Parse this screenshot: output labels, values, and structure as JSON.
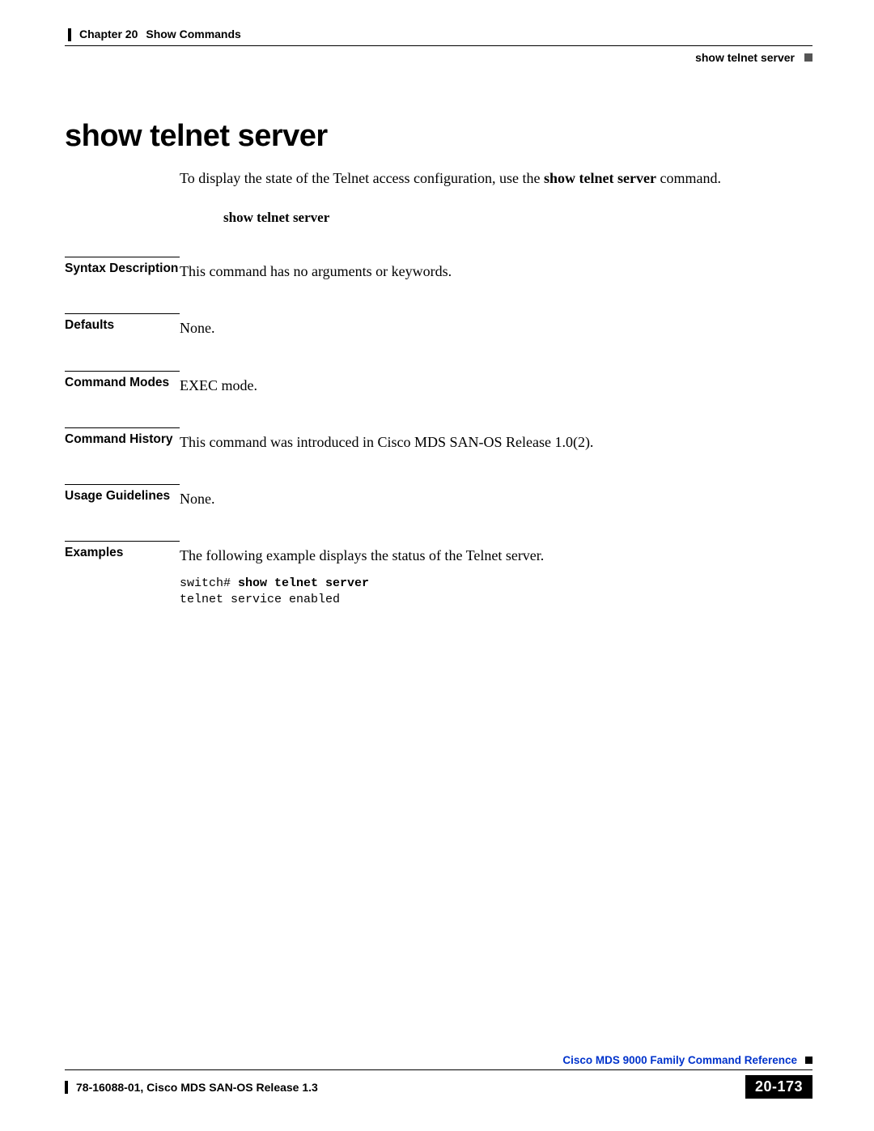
{
  "header": {
    "chapter_label": "Chapter 20",
    "chapter_title": "Show Commands",
    "section_name": "show telnet server"
  },
  "title": "show telnet server",
  "lead": {
    "prefix": "To display the state of the Telnet access configuration, use the ",
    "bold": "show telnet server",
    "suffix": " command."
  },
  "command_syntax": "show telnet server",
  "sections": {
    "syntax_description": {
      "label": "Syntax Description",
      "body": "This command has no arguments or keywords."
    },
    "defaults": {
      "label": "Defaults",
      "body": "None."
    },
    "command_modes": {
      "label": "Command Modes",
      "body": "EXEC mode."
    },
    "command_history": {
      "label": "Command History",
      "body": "This command was introduced in Cisco MDS SAN-OS Release 1.0(2)."
    },
    "usage_guidelines": {
      "label": "Usage Guidelines",
      "body": "None."
    },
    "examples": {
      "label": "Examples",
      "intro": "The following example displays the status of the Telnet server.",
      "code_prompt": "switch# ",
      "code_cmd": "show telnet server",
      "code_output": "telnet service enabled"
    }
  },
  "footer": {
    "doc_title": "Cisco MDS 9000 Family Command Reference",
    "doc_id": "78-16088-01, Cisco MDS SAN-OS Release 1.3",
    "page": "20-173"
  }
}
